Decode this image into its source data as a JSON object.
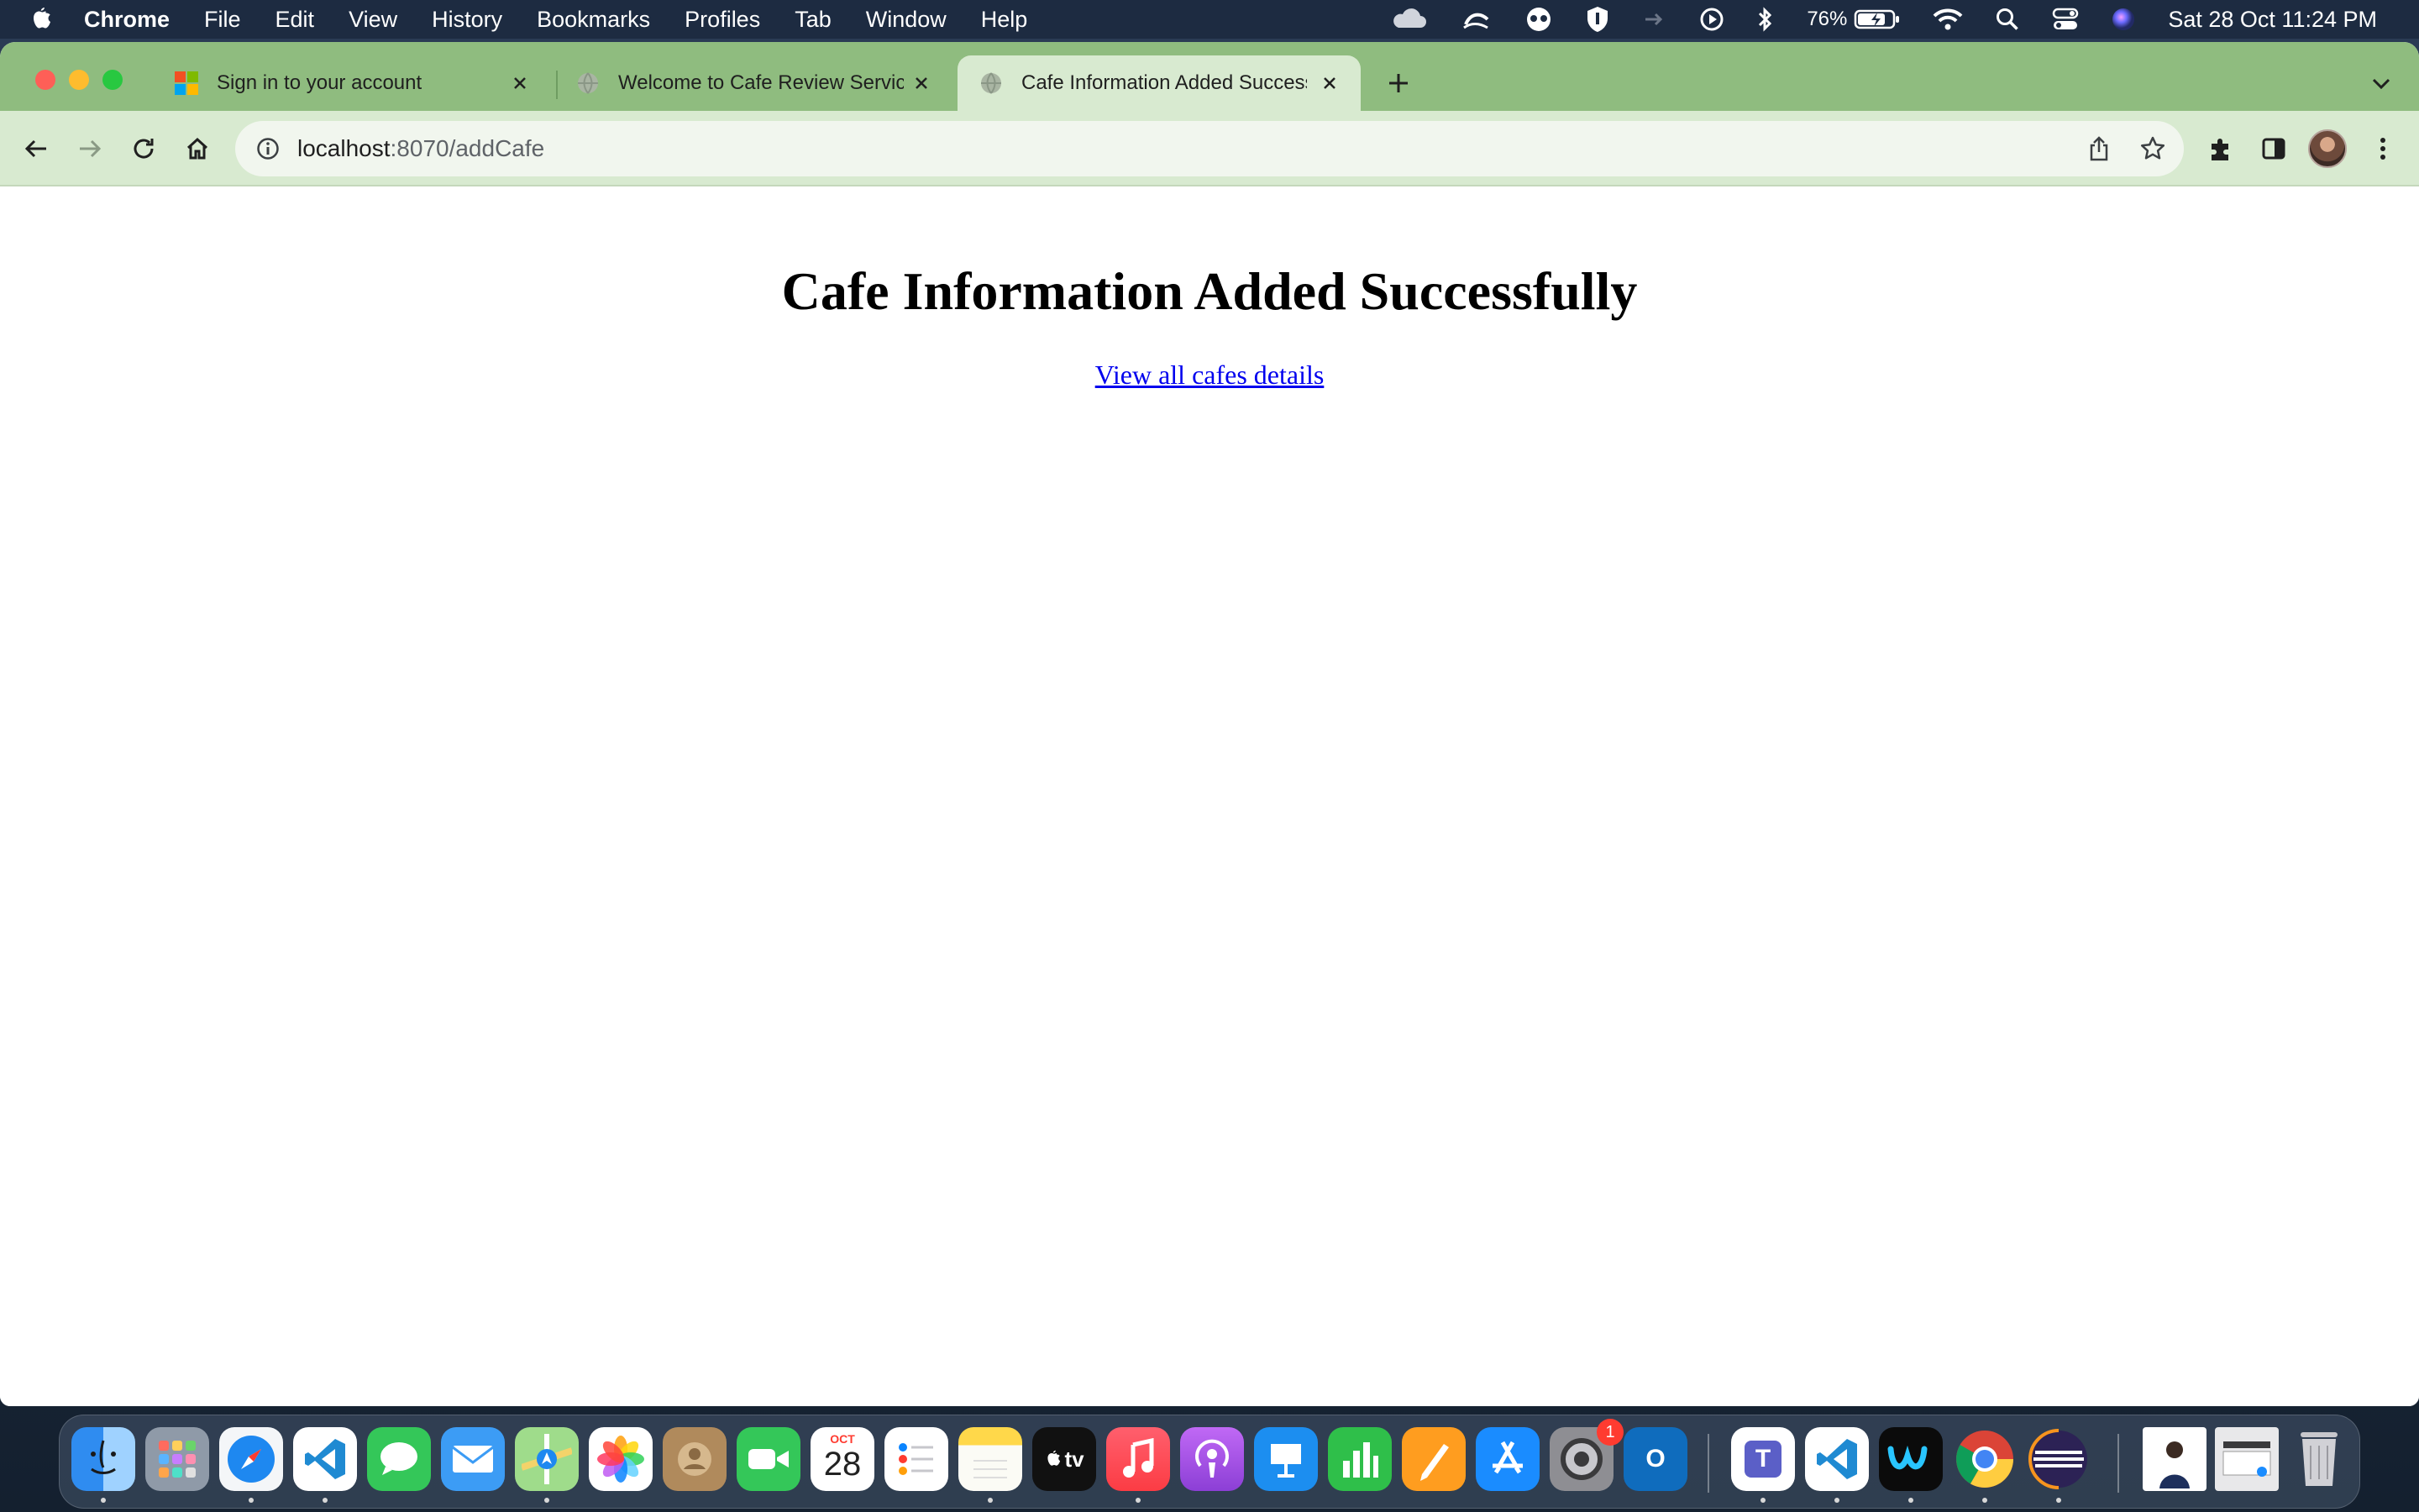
{
  "menubar": {
    "app_name": "Chrome",
    "items": [
      "File",
      "Edit",
      "View",
      "History",
      "Bookmarks",
      "Profiles",
      "Tab",
      "Window",
      "Help"
    ],
    "battery_percent": "76%",
    "clock": "Sat 28 Oct  11:24 PM",
    "status_icons": [
      "cloud-icon",
      "handoff-icon",
      "vpn-eye-icon",
      "shield-icon",
      "arrow-icon",
      "play-circle-icon",
      "bluetooth-icon",
      "battery-icon",
      "wifi-icon",
      "search-icon",
      "control-center-icon",
      "siri-icon"
    ]
  },
  "browser": {
    "tabs": [
      {
        "title": "Sign in to your account",
        "favicon": "microsoft-logo-icon",
        "active": false
      },
      {
        "title": "Welcome to Cafe Review Service",
        "favicon": "globe-icon",
        "active": false
      },
      {
        "title": "Cafe Information Added Successfully",
        "favicon": "globe-icon",
        "active": true
      }
    ],
    "address": {
      "host": "localhost",
      "rest": ":8070/addCafe"
    },
    "colors": {
      "frame": "#8fbc7f",
      "toolbar": "#d8ead0"
    }
  },
  "page": {
    "heading": "Cafe Information Added Successfully",
    "link_text": "View all cafes details",
    "link_color": "#0000ee"
  },
  "dock": {
    "apps": [
      "Finder",
      "Launchpad",
      "Safari",
      "Visual Studio Code",
      "Messages",
      "Mail",
      "Maps",
      "Photos",
      "Contacts",
      "FaceTime",
      "Calendar",
      "Reminders",
      "Notes",
      "Apple TV",
      "Music",
      "Podcasts",
      "Keynote",
      "Numbers",
      "Pages",
      "App Store",
      "System Settings",
      "Outlook",
      "Teams",
      "Visual Studio Code",
      "Webex",
      "Chrome",
      "Eclipse"
    ],
    "calendar_month": "OCT",
    "calendar_day": "28",
    "tv_label": "tv",
    "settings_badge": "1",
    "outlook_letter": "O",
    "teams_letter": "T"
  }
}
